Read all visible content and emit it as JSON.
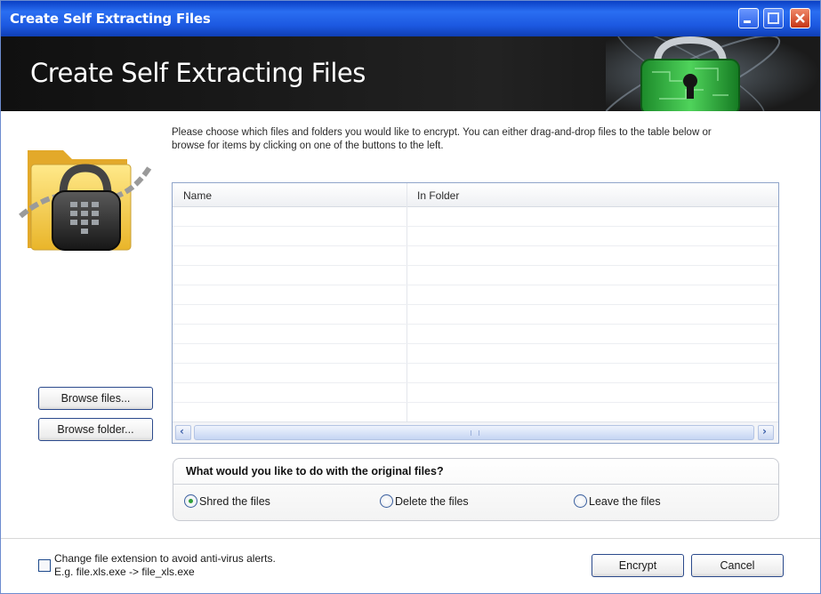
{
  "window": {
    "title": "Create Self Extracting Files",
    "controls": [
      "minimize-icon",
      "maximize-icon",
      "close-icon"
    ]
  },
  "banner": {
    "heading": "Create Self Extracting Files",
    "art_icon": "padlock-circuit-icon"
  },
  "side": {
    "art_icon": "locked-folder-icon"
  },
  "description": "Please choose which files and folders you would like to encrypt. You can either drag-and-drop files to the table below or browse for items by clicking on one of the buttons to the left.",
  "table": {
    "columns": [
      "Name",
      "In Folder"
    ],
    "rows": []
  },
  "buttons": {
    "browse_files": "Browse files...",
    "browse_folder": "Browse folder...",
    "encrypt": "Encrypt",
    "cancel": "Cancel"
  },
  "original_files": {
    "question": "What would you like to do with the original files?",
    "options": [
      "Shred the files",
      "Delete the files",
      "Leave the files"
    ],
    "selected": "Shred the files"
  },
  "extension_option": {
    "label_line1": "Change file extension to avoid anti-virus alerts.",
    "label_line2": "E.g. file.xls.exe -> file_xls.exe",
    "checked": false
  },
  "colors": {
    "titlebar": "#1c58e0",
    "banner": "#1a1a1a",
    "radio_selected": "#2f9e3a"
  }
}
